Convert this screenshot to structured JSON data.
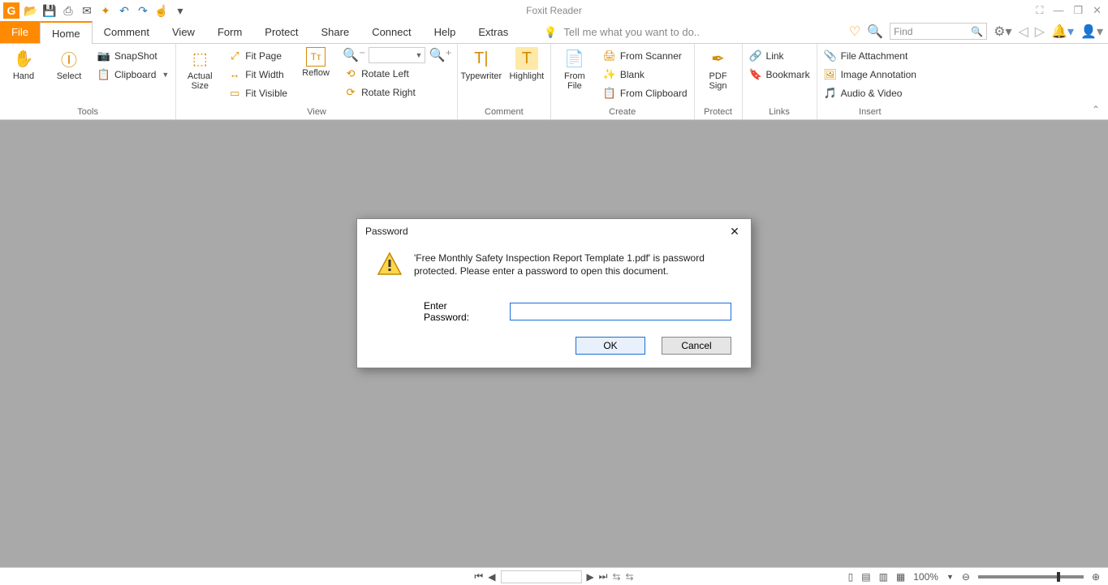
{
  "app": {
    "title": "Foxit Reader"
  },
  "qat": {
    "icons": [
      "app",
      "open",
      "save",
      "print",
      "mail",
      "new",
      "undo",
      "redo",
      "touch",
      "drop"
    ]
  },
  "tabs": {
    "file": "File",
    "items": [
      "Home",
      "Comment",
      "View",
      "Form",
      "Protect",
      "Share",
      "Connect",
      "Help",
      "Extras"
    ],
    "active": "Home",
    "tell_placeholder": "Tell me what you want to do.."
  },
  "search": {
    "placeholder": "Find"
  },
  "ribbon": {
    "tools": {
      "label": "Tools",
      "hand": "Hand",
      "select": "Select",
      "snapshot": "SnapShot",
      "clipboard": "Clipboard"
    },
    "view": {
      "label": "View",
      "actual": "Actual Size",
      "reflow": "Reflow",
      "fit_page": "Fit Page",
      "fit_width": "Fit Width",
      "fit_visible": "Fit Visible",
      "rotate_left": "Rotate Left",
      "rotate_right": "Rotate Right"
    },
    "comment": {
      "label": "Comment",
      "typewriter": "Typewriter",
      "highlight": "Highlight"
    },
    "create": {
      "label": "Create",
      "from_file": "From File",
      "from_scanner": "From Scanner",
      "blank": "Blank",
      "from_clipboard": "From Clipboard"
    },
    "protect": {
      "label": "Protect",
      "pdf_sign": "PDF Sign"
    },
    "links": {
      "label": "Links",
      "link": "Link",
      "bookmark": "Bookmark"
    },
    "insert": {
      "label": "Insert",
      "file_attachment": "File Attachment",
      "image_annotation": "Image Annotation",
      "audio_video": "Audio & Video"
    }
  },
  "dialog": {
    "title": "Password",
    "message": "'Free Monthly Safety Inspection Report Template 1.pdf' is password protected. Please enter a password to open this document.",
    "field_label": "Enter Password:",
    "ok": "OK",
    "cancel": "Cancel"
  },
  "status": {
    "zoom": "100%"
  }
}
